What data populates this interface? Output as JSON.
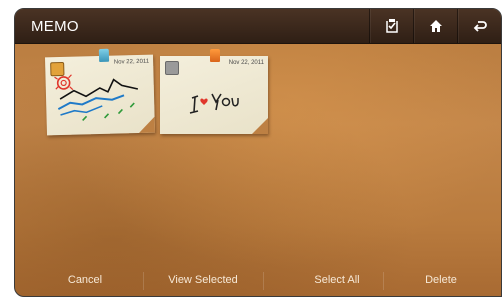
{
  "app": {
    "title": "MEMO"
  },
  "topbar": {
    "icons": [
      "selection-icon",
      "home-icon",
      "back-icon"
    ]
  },
  "memos": [
    {
      "date": "Nov 22, 2011",
      "checked": true,
      "pin_color": "#4fb3d4",
      "content": "drawing"
    },
    {
      "date": "Nov 22, 2011",
      "checked": false,
      "pin_color": "#f07a2a",
      "handwriting": "I♥You"
    }
  ],
  "bottombar": {
    "cancel": "Cancel",
    "view_selected": "View Selected",
    "select_all": "Select All",
    "delete": "Delete"
  }
}
